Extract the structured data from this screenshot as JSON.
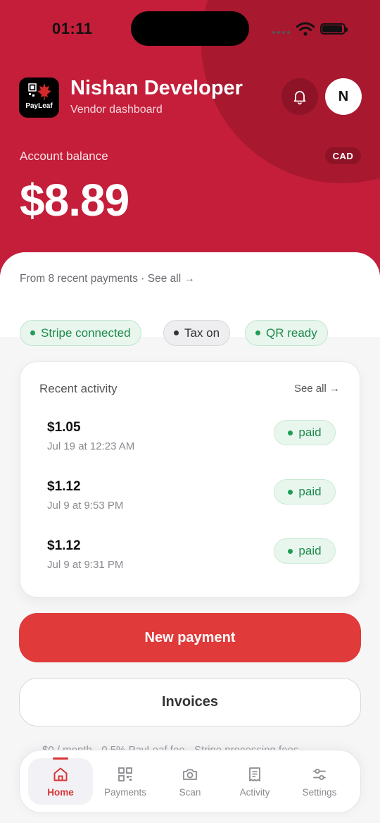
{
  "status_bar": {
    "time": "01:11"
  },
  "header": {
    "logo_text": "PayLeaf",
    "user_name": "Nishan Developer",
    "user_role": "Vendor dashboard",
    "avatar_initial": "N",
    "balance_label": "Account balance",
    "currency": "CAD",
    "balance": "$8.89",
    "colors": {
      "primary": "#c41e3a",
      "accent": "#e03a3a"
    }
  },
  "summary": {
    "recent_note": "From 8 recent payments · See all →"
  },
  "chips": [
    {
      "label": "Stripe connected",
      "status": "green"
    },
    {
      "label": "Tax on",
      "status": "gray"
    },
    {
      "label": "QR ready",
      "status": "green"
    }
  ],
  "activity": {
    "title": "Recent activity",
    "see_all": "See all →",
    "items": [
      {
        "amount": "$1.05",
        "date": "Jul 19 at 12:23 AM",
        "status": "paid"
      },
      {
        "amount": "$1.12",
        "date": "Jul 9 at 9:53 PM",
        "status": "paid"
      },
      {
        "amount": "$1.12",
        "date": "Jul 9 at 9:31 PM",
        "status": "paid"
      }
    ]
  },
  "actions": {
    "new_payment": "New payment",
    "invoices": "Invoices"
  },
  "footer_note": "$0 / month · 0.5% PayLeaf fee · Stripe processing fees",
  "tabs": [
    {
      "label": "Home",
      "icon": "home-icon",
      "active": true
    },
    {
      "label": "Payments",
      "icon": "qr-code-icon",
      "active": false
    },
    {
      "label": "Scan",
      "icon": "camera-icon",
      "active": false
    },
    {
      "label": "Activity",
      "icon": "receipt-icon",
      "active": false
    },
    {
      "label": "Settings",
      "icon": "sliders-icon",
      "active": false
    }
  ]
}
